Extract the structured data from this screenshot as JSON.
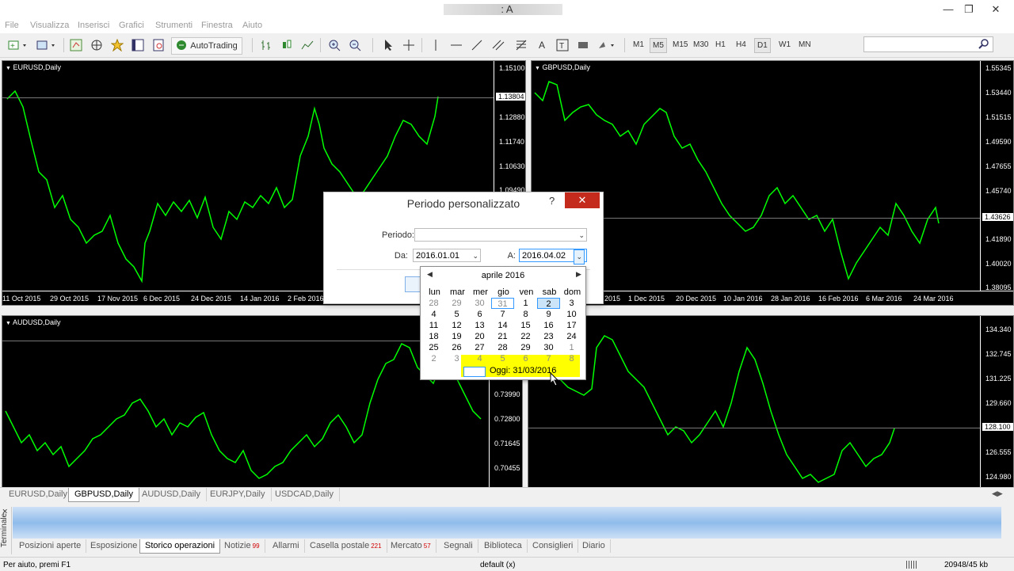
{
  "window": {
    "title": ": A",
    "minimize": "—",
    "maximize": "❐",
    "close": "✕"
  },
  "menu": [
    "File",
    "Visualizza",
    "Inserisci",
    "Grafici",
    "Strumenti",
    "Finestra",
    "Aiuto"
  ],
  "toolbar": {
    "autotrading": "AutoTrading",
    "text_tool": "A",
    "timeframes": [
      "M1",
      "M5",
      "M15",
      "M30",
      "H1",
      "H4",
      "D1",
      "W1",
      "MN"
    ],
    "active_timeframe": "M5"
  },
  "charts": {
    "eurusd": {
      "title": "EURUSD,Daily",
      "prices": [
        "1.15100",
        "1.13804",
        "1.12880",
        "1.11740",
        "1.10630",
        "1.09490"
      ],
      "current": "1.13804",
      "dates": [
        "11 Oct 2015",
        "29 Oct 2015",
        "17 Nov 2015",
        "6 Dec 2015",
        "24 Dec 2015",
        "14 Jan 2016",
        "2 Feb 2016"
      ]
    },
    "gbpusd": {
      "title": "GBPUSD,Daily",
      "prices": [
        "1.55345",
        "1.53440",
        "1.51515",
        "1.49590",
        "1.47655",
        "1.45740",
        "1.43626",
        "1.41890",
        "1.40020",
        "1.38095"
      ],
      "current": "1.43626",
      "dates": [
        "2015",
        "1 Dec 2015",
        "20 Dec 2015",
        "10 Jan 2016",
        "28 Jan 2016",
        "16 Feb 2016",
        "6 Mar 2016",
        "24 Mar 2016"
      ]
    },
    "audusd": {
      "title": "AUDUSD,Daily",
      "prices": [
        "0.73990",
        "0.72800",
        "0.71645",
        "0.70455"
      ]
    },
    "eurjpy": {
      "prices": [
        "134.340",
        "132.745",
        "131.225",
        "129.660",
        "128.100",
        "126.555",
        "124.980"
      ],
      "current": "128.100"
    }
  },
  "chart_tabs": [
    "EURUSD,Daily",
    "GBPUSD,Daily",
    "AUDUSD,Daily",
    "EURJPY,Daily",
    "USDCAD,Daily"
  ],
  "active_chart_tab": "GBPUSD,Daily",
  "terminal": {
    "label": "Terminale",
    "tabs": [
      {
        "label": "Posizioni aperte"
      },
      {
        "label": "Esposizione"
      },
      {
        "label": "Storico operazioni",
        "active": true
      },
      {
        "label": "Notizie",
        "badge": "99"
      },
      {
        "label": "Allarmi"
      },
      {
        "label": "Casella postale",
        "badge": "221"
      },
      {
        "label": "Mercato",
        "badge": "57"
      },
      {
        "label": "Segnali"
      },
      {
        "label": "Biblioteca"
      },
      {
        "label": "Consiglieri"
      },
      {
        "label": "Diario"
      }
    ]
  },
  "statusbar": {
    "help": "Per aiuto, premi F1",
    "profile": "default (x)",
    "traffic": "20948/45 kb"
  },
  "dialog": {
    "title": "Periodo personalizzato",
    "help": "?",
    "close": "✕",
    "periodo_label": "Periodo:",
    "periodo_value": "",
    "da_label": "Da:",
    "da_value": "2016.01.01",
    "a_label": "A:",
    "a_value": "2016.04.02"
  },
  "calendar": {
    "month": "aprile 2016",
    "prev": "◀",
    "next": "▶",
    "weekdays": [
      "lun",
      "mar",
      "mer",
      "gio",
      "ven",
      "sab",
      "dom"
    ],
    "weeks": [
      [
        "28",
        "29",
        "30",
        "31",
        "1",
        "2",
        "3"
      ],
      [
        "4",
        "5",
        "6",
        "7",
        "8",
        "9",
        "10"
      ],
      [
        "11",
        "12",
        "13",
        "14",
        "15",
        "16",
        "17"
      ],
      [
        "18",
        "19",
        "20",
        "21",
        "22",
        "23",
        "24"
      ],
      [
        "25",
        "26",
        "27",
        "28",
        "29",
        "30",
        "1"
      ],
      [
        "2",
        "3",
        "4",
        "5",
        "6",
        "7",
        "8"
      ]
    ],
    "today_text": "Oggi: 31/03/2016",
    "colors": {
      "highlight": "#ffff00",
      "selection_border": "#3399ff"
    }
  },
  "colors": {
    "candle": "#00ff00",
    "chart_bg": "#000000",
    "dialog_close": "#c42b1c"
  }
}
